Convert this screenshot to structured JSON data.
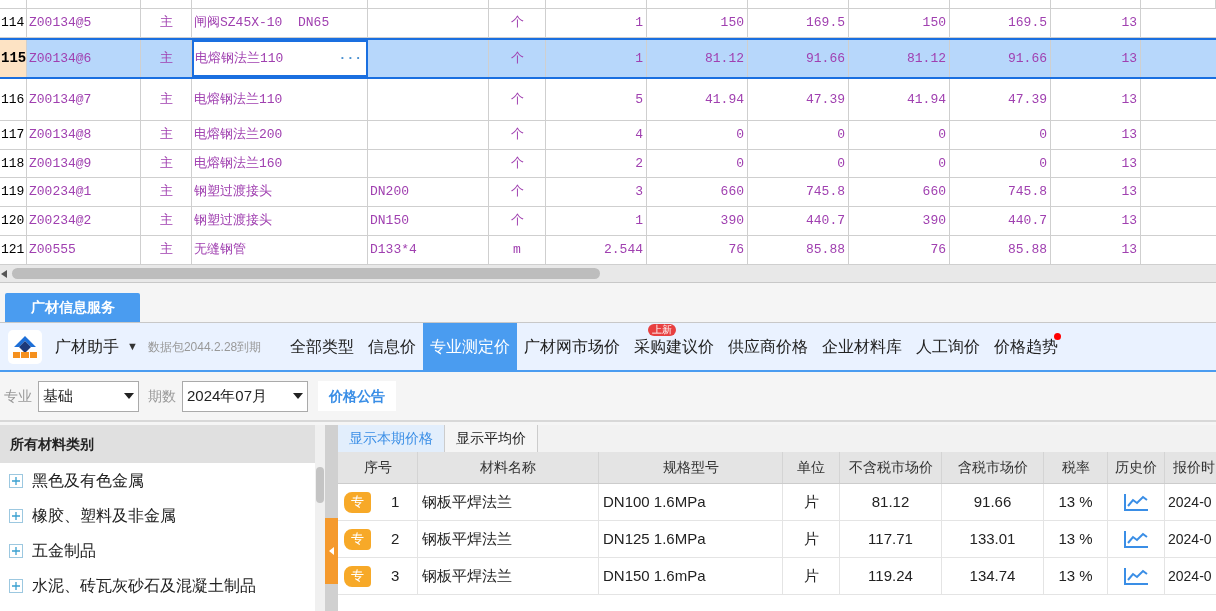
{
  "grid": {
    "edit_button": "···",
    "rows": [
      {
        "num": "114",
        "code": "Z00134@5",
        "type": "主",
        "name": "闸阀SZ45X-10  DN65",
        "spec": "",
        "unit": "个",
        "values": [
          "1",
          "150",
          "169.5",
          "150",
          "169.5",
          "13"
        ],
        "selected": false
      },
      {
        "num": "115",
        "code": "Z00134@6",
        "type": "主",
        "name": "电熔钢法兰110",
        "spec": "",
        "unit": "个",
        "values": [
          "1",
          "81.12",
          "91.66",
          "81.12",
          "91.66",
          "13"
        ],
        "selected": true
      },
      {
        "num": "116",
        "code": "Z00134@7",
        "type": "主",
        "name": "电熔钢法兰110",
        "spec": "",
        "unit": "个",
        "values": [
          "5",
          "41.94",
          "47.39",
          "41.94",
          "47.39",
          "13"
        ],
        "selected": false
      },
      {
        "num": "117",
        "code": "Z00134@8",
        "type": "主",
        "name": "电熔钢法兰200",
        "spec": "",
        "unit": "个",
        "values": [
          "4",
          "0",
          "0",
          "0",
          "0",
          "13"
        ],
        "selected": false
      },
      {
        "num": "118",
        "code": "Z00134@9",
        "type": "主",
        "name": "电熔钢法兰160",
        "spec": "",
        "unit": "个",
        "values": [
          "2",
          "0",
          "0",
          "0",
          "0",
          "13"
        ],
        "selected": false
      },
      {
        "num": "119",
        "code": "Z00234@1",
        "type": "主",
        "name": "钢塑过渡接头",
        "spec": "DN200",
        "unit": "个",
        "values": [
          "3",
          "660",
          "745.8",
          "660",
          "745.8",
          "13"
        ],
        "selected": false
      },
      {
        "num": "120",
        "code": "Z00234@2",
        "type": "主",
        "name": "钢塑过渡接头",
        "spec": "DN150",
        "unit": "个",
        "values": [
          "1",
          "390",
          "440.7",
          "390",
          "440.7",
          "13"
        ],
        "selected": false
      },
      {
        "num": "121",
        "code": "Z00555",
        "type": "主",
        "name": "无缝钢管",
        "spec": "D133*4",
        "unit": "m",
        "values": [
          "2.544",
          "76",
          "85.88",
          "76",
          "85.88",
          "13"
        ],
        "selected": false
      }
    ]
  },
  "panel_tab": "广材信息服务",
  "toolbar": {
    "app_name": "广材助手",
    "caret": "▼",
    "expiry": "数据包2044.2.28到期",
    "tabs": [
      {
        "label": "全部类型",
        "selected": false,
        "dot": false
      },
      {
        "label": "信息价",
        "selected": false,
        "dot": false
      },
      {
        "label": "专业测定价",
        "selected": true,
        "dot": false
      },
      {
        "label": "广材网市场价",
        "selected": false,
        "dot": false
      },
      {
        "label": "采购建议价",
        "selected": false,
        "dot": false,
        "badge": "上新"
      },
      {
        "label": "供应商价格",
        "selected": false,
        "dot": false
      },
      {
        "label": "企业材料库",
        "selected": false,
        "dot": false
      },
      {
        "label": "人工询价",
        "selected": false,
        "dot": false
      },
      {
        "label": "价格趋势",
        "selected": false,
        "dot": true
      }
    ]
  },
  "filters": {
    "specialty_label": "专业",
    "specialty": "基础",
    "period_label": "期数",
    "period": "2024年07月",
    "notice_button": "价格公告"
  },
  "categories": {
    "title": "所有材料类别",
    "items": [
      {
        "label": "黑色及有色金属",
        "expanded": false
      },
      {
        "label": "橡胶、塑料及非金属",
        "expanded": false
      },
      {
        "label": "五金制品",
        "expanded": false
      },
      {
        "label": "水泥、砖瓦灰砂石及混凝土制品",
        "expanded": false
      }
    ]
  },
  "price_tabs": [
    {
      "label": "显示本期价格",
      "selected": true
    },
    {
      "label": "显示平均价",
      "selected": false
    }
  ],
  "prices": {
    "columns": [
      "序号",
      "材料名称",
      "规格型号",
      "单位",
      "不含税市场价",
      "含税市场价",
      "税率",
      "历史价",
      "报价时"
    ],
    "rows": [
      {
        "tag": "专",
        "no": "1",
        "name": "钢板平焊法兰",
        "spec": "DN100 1.6MPa",
        "unit": "片",
        "excl": "81.12",
        "incl": "91.66",
        "tax": "13 %",
        "date": "2024-0"
      },
      {
        "tag": "专",
        "no": "2",
        "name": "钢板平焊法兰",
        "spec": "DN125 1.6MPa",
        "unit": "片",
        "excl": "117.71",
        "incl": "133.01",
        "tax": "13 %",
        "date": "2024-0"
      },
      {
        "tag": "专",
        "no": "3",
        "name": "钢板平焊法兰",
        "spec": "DN150 1.6mPa",
        "unit": "片",
        "excl": "119.24",
        "incl": "134.74",
        "tax": "13 %",
        "date": "2024-0"
      }
    ]
  }
}
